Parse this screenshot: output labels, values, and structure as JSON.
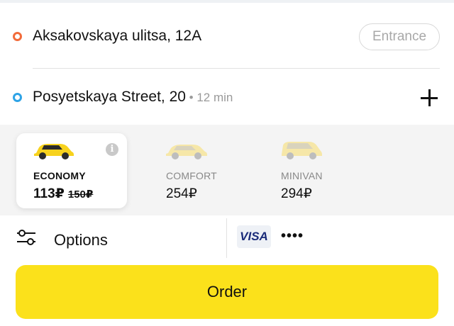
{
  "route": {
    "from": {
      "address": "Aksakovskaya ulitsa, 12A",
      "entrance_label": "Entrance"
    },
    "to": {
      "address": "Posyetskaya Street, 20",
      "eta": " • 12 min"
    }
  },
  "tariffs": [
    {
      "name": "ECONOMY",
      "price": "113₽",
      "old_price": "150₽",
      "selected": true,
      "info_icon": "i"
    },
    {
      "name": "COMFORT",
      "price": "254₽",
      "selected": false
    },
    {
      "name": "MINIVAN",
      "price": "294₽",
      "selected": false
    }
  ],
  "options": {
    "label": "Options",
    "icon": "sliders-icon"
  },
  "payment": {
    "card_brand": "VISA",
    "card_mask": "••••"
  },
  "order": {
    "label": "Order"
  },
  "colors": {
    "accent_yellow": "#fbe11b",
    "from_dot": "#f26b3a",
    "to_dot": "#2ea3e6",
    "selected_card_bg": "#ffffff",
    "tariff_strip_bg": "#f4f4f4"
  }
}
